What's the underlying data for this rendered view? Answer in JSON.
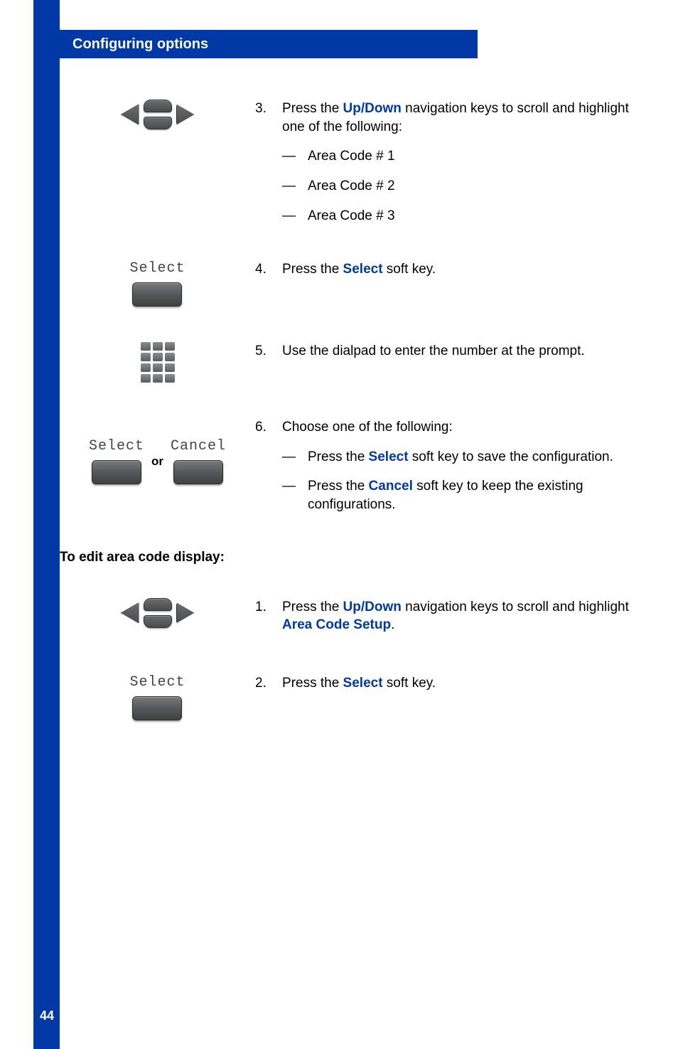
{
  "header": {
    "title": "Configuring options"
  },
  "pagenum": "44",
  "steps": {
    "s3": {
      "num": "3.",
      "text_a": "Press the ",
      "key1": "Up/Down",
      "text_b": " navigation keys to scroll and highlight one of the following:",
      "sub1": "Area Code # 1",
      "sub2": "Area Code # 2",
      "sub3": "Area Code # 3"
    },
    "s4": {
      "num": "4.",
      "text_a": "Press the ",
      "key1": "Select",
      "text_b": " soft key.",
      "lcd": "Select"
    },
    "s5": {
      "num": "5.",
      "text": "Use the dialpad to enter the number at the prompt."
    },
    "s6": {
      "num": "6.",
      "text": "Choose one of the following:",
      "sub1_a": "Press the ",
      "sub1_key": "Select",
      "sub1_b": " soft key to save the configuration.",
      "sub2_a": "Press the ",
      "sub2_key": "Cancel",
      "sub2_b": " soft key to keep the existing configurations.",
      "lcd_left": "Select",
      "or": "or",
      "lcd_right": "Cancel"
    }
  },
  "section2": {
    "heading": "To edit area code display:"
  },
  "steps2": {
    "s1": {
      "num": "1.",
      "text_a": "Press the ",
      "key1": "Up/Down",
      "text_b": " navigation keys to scroll and highlight ",
      "key2": "Area Code Setup",
      "text_c": "."
    },
    "s2": {
      "num": "2.",
      "text_a": "Press the ",
      "key1": "Select",
      "text_b": " soft key.",
      "lcd": "Select"
    }
  }
}
